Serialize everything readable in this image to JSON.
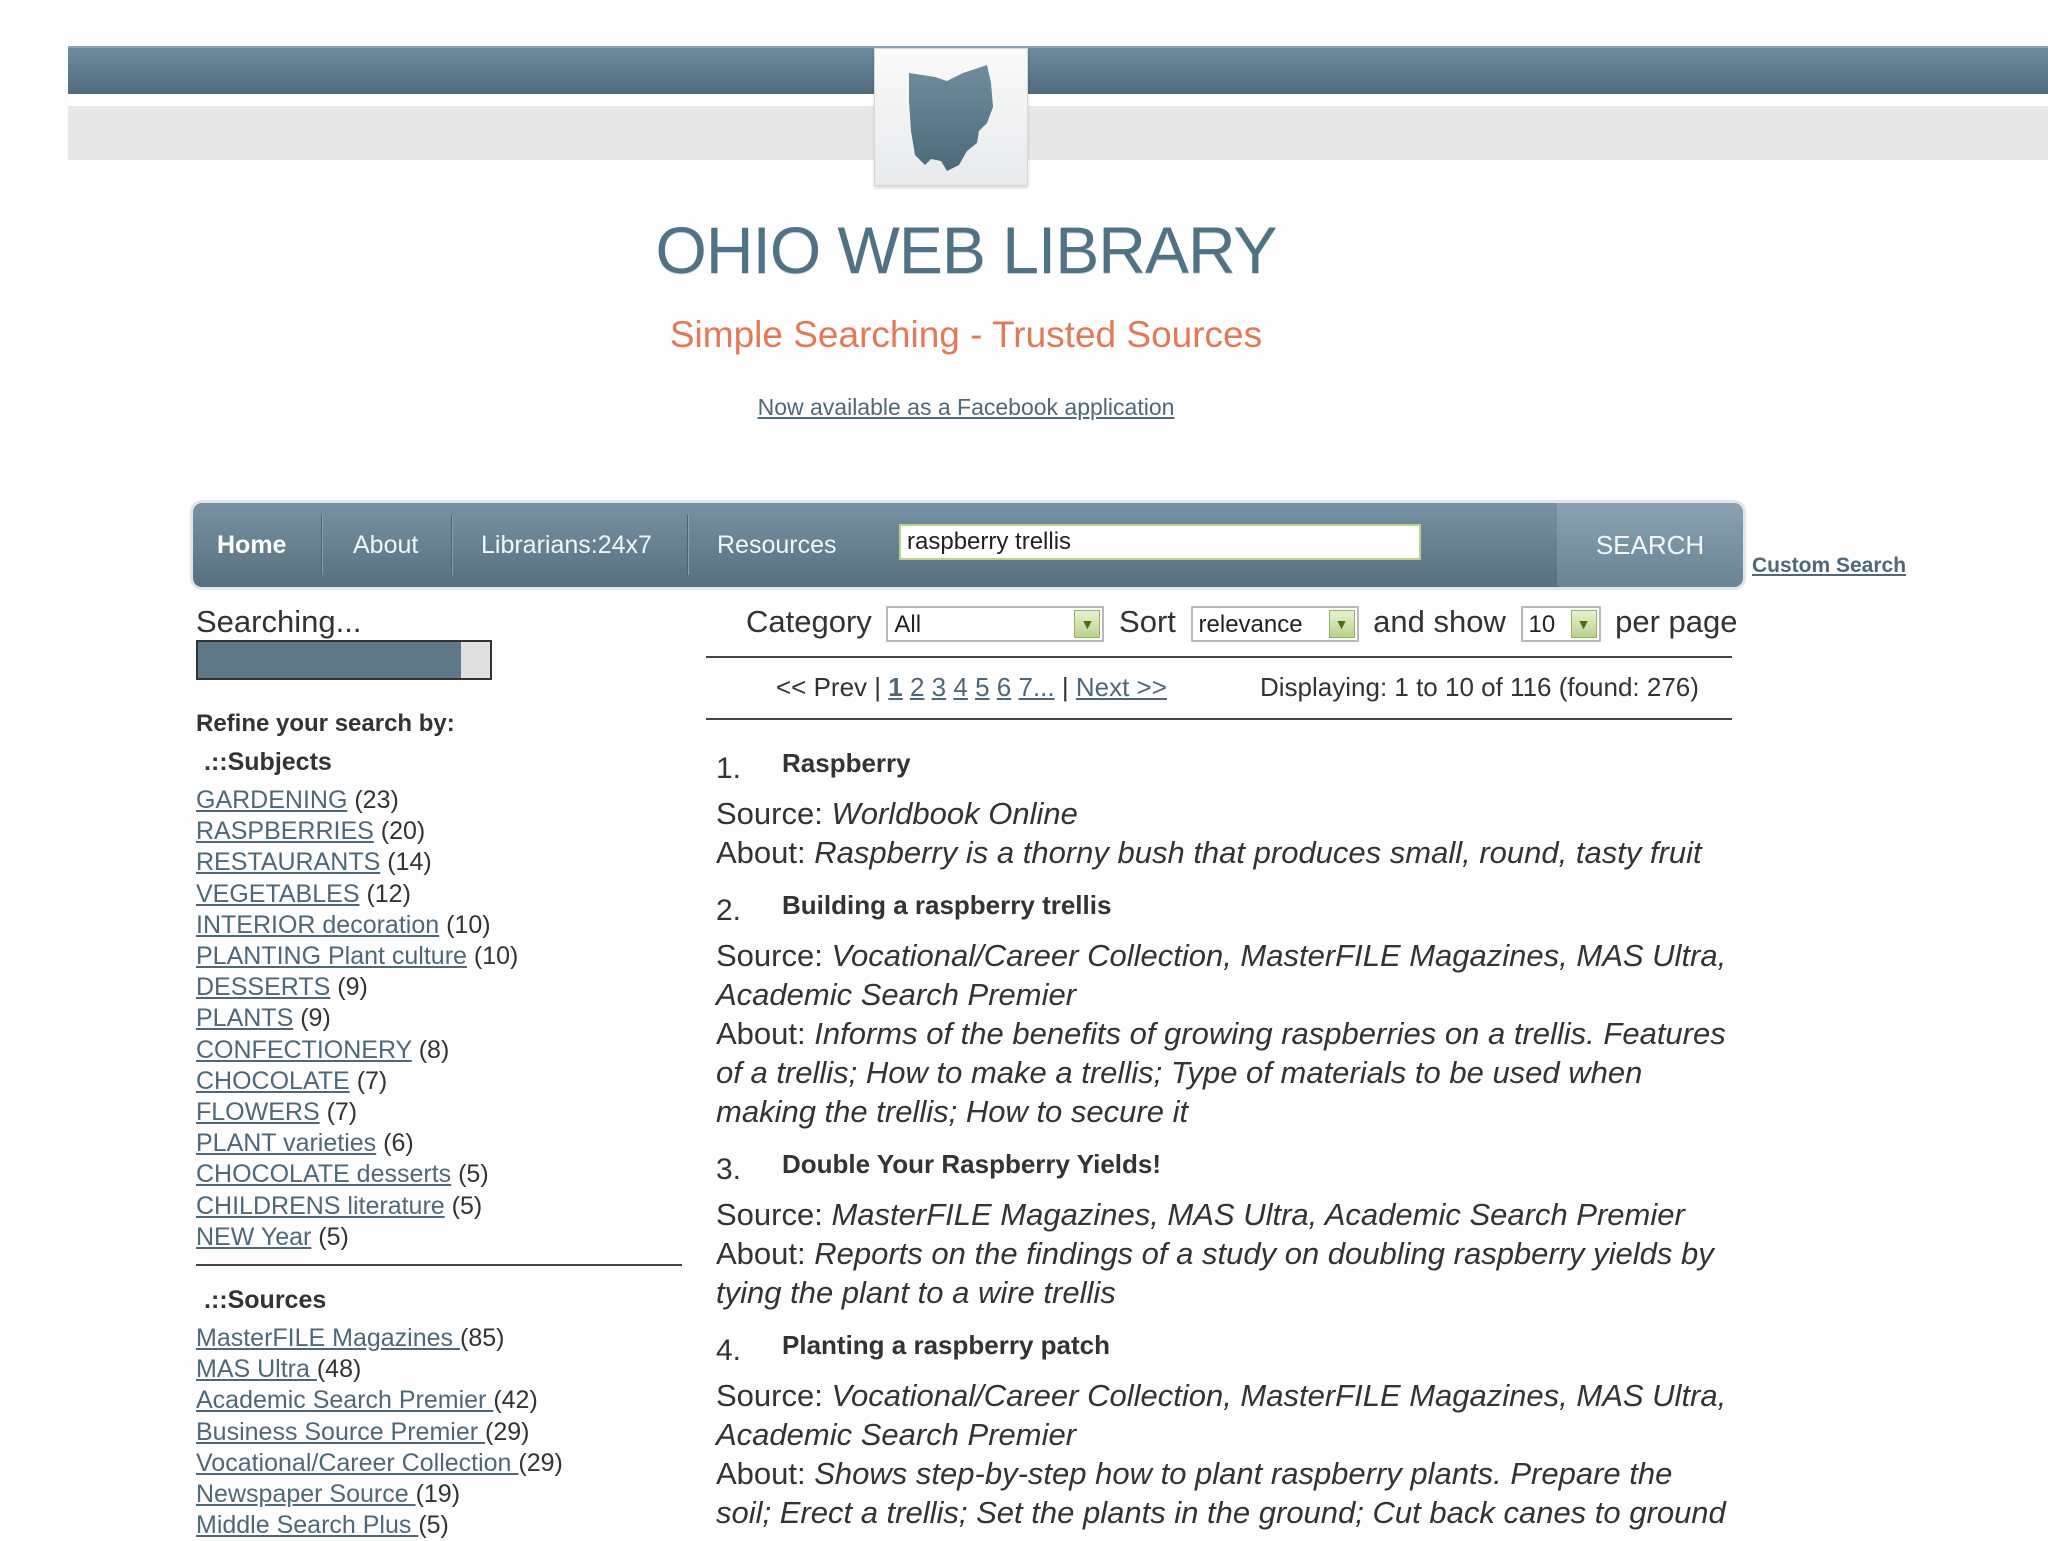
{
  "header": {
    "logo_icon": "ohio-state-outline-icon",
    "site_title": "OHIO WEB LIBRARY",
    "tagline": "Simple Searching - Trusted Sources",
    "facebook_link": "Now available as a Facebook application"
  },
  "nav": {
    "items": [
      "Home",
      "About",
      "Librarians:24x7",
      "Resources"
    ],
    "search_value": "raspberry trellis",
    "search_button": "SEARCH",
    "custom_search": "Custom Search"
  },
  "sidebar": {
    "searching_label": "Searching...",
    "progress_fraction": 0.9,
    "refine_label": "Refine your search by:",
    "subjects_heading": ".::Subjects",
    "subjects": [
      {
        "label": "GARDENING",
        "count": "(23)"
      },
      {
        "label": "RASPBERRIES",
        "count": "(20)"
      },
      {
        "label": "RESTAURANTS",
        "count": "(14)"
      },
      {
        "label": "VEGETABLES",
        "count": "(12)"
      },
      {
        "label": "INTERIOR decoration",
        "count": "(10)"
      },
      {
        "label": "PLANTING Plant culture",
        "count": "(10)"
      },
      {
        "label": "DESSERTS",
        "count": "(9)"
      },
      {
        "label": "PLANTS",
        "count": "(9)"
      },
      {
        "label": "CONFECTIONERY",
        "count": "(8)"
      },
      {
        "label": "CHOCOLATE",
        "count": "(7)"
      },
      {
        "label": "FLOWERS",
        "count": "(7)"
      },
      {
        "label": "PLANT varieties",
        "count": "(6)"
      },
      {
        "label": "CHOCOLATE desserts",
        "count": "(5)"
      },
      {
        "label": "CHILDRENS literature",
        "count": "(5)"
      },
      {
        "label": "NEW Year",
        "count": "(5)"
      }
    ],
    "sources_heading": ".::Sources",
    "sources": [
      {
        "label": "MasterFILE Magazines ",
        "count": "(85)"
      },
      {
        "label": "MAS Ultra ",
        "count": "(48)"
      },
      {
        "label": "Academic Search Premier ",
        "count": "(42)"
      },
      {
        "label": "Business Source Premier ",
        "count": "(29)"
      },
      {
        "label": "Vocational/Career Collection ",
        "count": "(29)"
      },
      {
        "label": "Newspaper Source ",
        "count": "(19)"
      },
      {
        "label": "Middle Search Plus ",
        "count": "(5)"
      }
    ]
  },
  "controls": {
    "category_label": "Category",
    "category_value": "All",
    "sort_label": "Sort",
    "sort_value": "relevance",
    "show_label": "and show",
    "show_value": "10",
    "per_page_label": "per page"
  },
  "pager": {
    "prev": "<< Prev |",
    "current": "1",
    "pages": [
      "2",
      "3",
      "4",
      "5",
      "6",
      "7",
      "..."
    ],
    "sep": "|",
    "next": "Next >>",
    "display": "Displaying: 1 to 10 of 116 (found: 276)"
  },
  "labels": {
    "source": "Source:",
    "about": "About:"
  },
  "results": [
    {
      "num": "1.",
      "title": "Raspberry",
      "source": "Worldbook Online",
      "about": "Raspberry is a thorny bush that produces small, round, tasty fruit"
    },
    {
      "num": "2.",
      "title": "Building a raspberry trellis",
      "source": "Vocational/Career Collection, MasterFILE Magazines, MAS Ultra, Academic Search Premier",
      "about": "Informs of the benefits of growing raspberries on a trellis. Features of a trellis; How to make a trellis; Type of materials to be used when making the trellis; How to secure it"
    },
    {
      "num": "3.",
      "title": "Double Your Raspberry Yields!",
      "source": "MasterFILE Magazines, MAS Ultra, Academic Search Premier",
      "about": "Reports on the findings of a study on doubling raspberry yields by tying the plant to a wire trellis"
    },
    {
      "num": "4.",
      "title": "Planting a raspberry patch",
      "source": "Vocational/Career Collection, MasterFILE Magazines, MAS Ultra, Academic Search Premier",
      "about": "Shows step-by-step how to plant raspberry plants. Prepare the soil; Erect a trellis; Set the plants in the ground; Cut back canes to ground"
    }
  ]
}
